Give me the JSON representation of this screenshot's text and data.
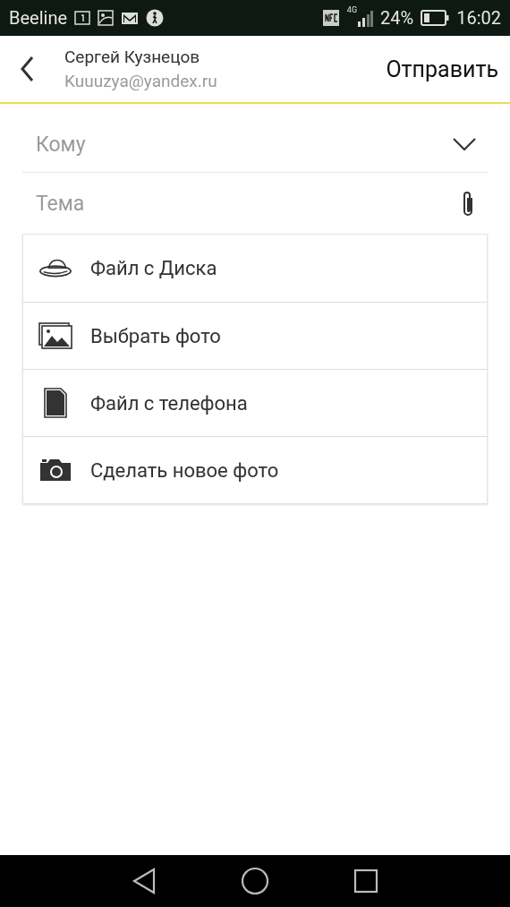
{
  "status_bar": {
    "carrier": "Beeline",
    "network": "4G",
    "battery": "24%",
    "time": "16:02"
  },
  "header": {
    "name": "Сергей Кузнецов",
    "email": "Kuuuzya@yandex.ru",
    "send": "Отправить"
  },
  "fields": [
    {
      "kind": "to",
      "placeholder": "Кому"
    },
    {
      "kind": "subject",
      "placeholder": "Тема"
    }
  ],
  "attach_menu": [
    {
      "kind": "disk",
      "label": "Файл с Диска"
    },
    {
      "kind": "gallery",
      "label": "Выбрать фото"
    },
    {
      "kind": "file",
      "label": "Файл с телефона"
    },
    {
      "kind": "camera",
      "label": "Сделать новое фото"
    }
  ]
}
